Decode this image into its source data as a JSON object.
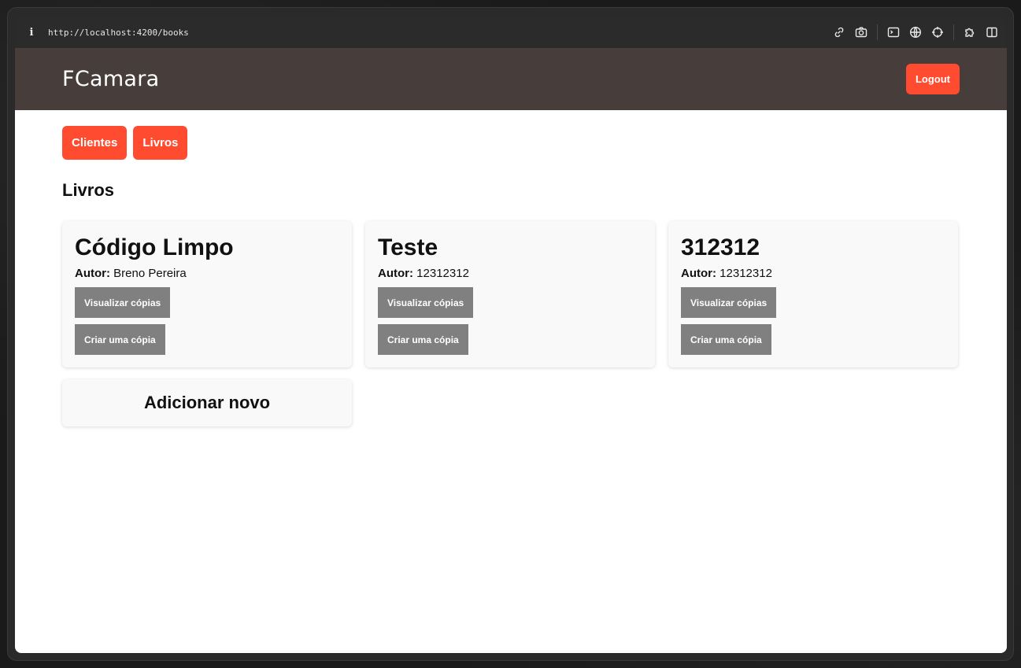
{
  "browser": {
    "url": "http://localhost:4200/books",
    "icons": [
      "info-icon",
      "link-icon",
      "camera-icon",
      "terminal-icon",
      "globe-icon",
      "crosshair-icon",
      "puzzle-icon",
      "sidebar-icon"
    ]
  },
  "header": {
    "logo": "FCamara",
    "logout_label": "Logout"
  },
  "nav": {
    "clients_label": "Clientes",
    "books_label": "Livros"
  },
  "page_title": "Livros",
  "books": [
    {
      "title": "Código Limpo",
      "author_label": "Autor:",
      "author": "Breno Pereira",
      "view_label": "Visualizar cópias",
      "create_label": "Criar uma cópia"
    },
    {
      "title": "Teste",
      "author_label": "Autor:",
      "author": "12312312",
      "view_label": "Visualizar cópias",
      "create_label": "Criar uma cópia"
    },
    {
      "title": "312312",
      "author_label": "Autor:",
      "author": "12312312",
      "view_label": "Visualizar cópias",
      "create_label": "Criar uma cópia"
    }
  ],
  "add_new_label": "Adicionar novo",
  "colors": {
    "accent": "#ff4c30",
    "header_bg": "#473d3a",
    "secondary_button": "#808080"
  }
}
